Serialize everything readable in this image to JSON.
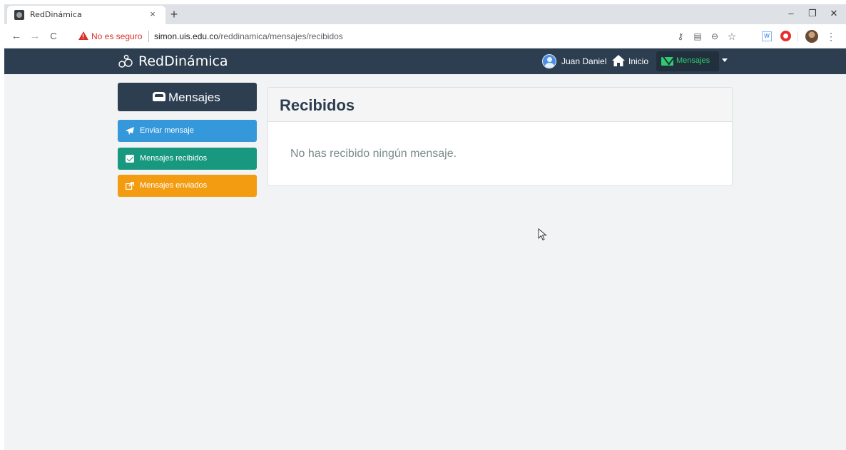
{
  "browser": {
    "tab_title": "RedDinámica",
    "tab_close": "×",
    "new_tab": "+",
    "window_controls": {
      "minimize": "–",
      "restore": "❐",
      "close": "✕"
    },
    "nav": {
      "back": "←",
      "forward": "→",
      "reload": "C"
    },
    "security_label": "No es seguro",
    "url_host": "simon.uis.edu.co",
    "url_path": "/reddinamica/mensajes/recibidos",
    "toolbar_icons": [
      "key-icon",
      "translate-icon",
      "zoom-icon",
      "star-icon",
      "word-extension-icon",
      "opera-extension-icon",
      "profile-avatar",
      "menu-icon"
    ]
  },
  "navbar": {
    "brand": "RedDinámica",
    "user_name": "Juan Daniel",
    "home_label": "Inicio",
    "messages_label": "Mensajes"
  },
  "sidebar": {
    "header": "Mensajes",
    "buttons": [
      {
        "label": "Enviar mensaje",
        "color": "#3498db",
        "icon": "paper-plane-icon"
      },
      {
        "label": "Mensajes recibidos",
        "color": "#17987f",
        "icon": "check-square-icon"
      },
      {
        "label": "Mensajes enviados",
        "color": "#f39c12",
        "icon": "share-square-icon"
      }
    ]
  },
  "panel": {
    "title": "Recibidos",
    "empty_message": "No has recibido ningún mensaje."
  },
  "colors": {
    "navbar_bg": "#2d3e50",
    "accent_green": "#2ecc71",
    "page_bg": "#f1f3f4"
  }
}
